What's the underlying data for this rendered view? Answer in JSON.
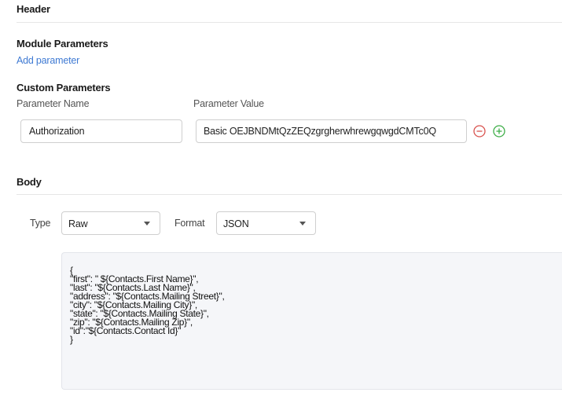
{
  "header": {
    "title": "Header"
  },
  "module_parameters": {
    "title": "Module Parameters",
    "add_link": "Add parameter"
  },
  "custom_parameters": {
    "title": "Custom Parameters",
    "name_column": "Parameter Name",
    "value_column": "Parameter Value",
    "rows": [
      {
        "name": "Authorization",
        "value": "Basic OEJBNDMtQzZEQzgrgherwhrewgqwgdCMTc0Q"
      }
    ]
  },
  "body": {
    "title": "Body",
    "type_label": "Type",
    "type_value": "Raw",
    "format_label": "Format",
    "format_value": "JSON",
    "code_lines": [
      "{",
      "\"first\": \" ${Contacts.First Name}\",",
      "\"last\": \"${Contacts.Last Name}\",",
      "\"address\": \"${Contacts.Mailing Street}\",",
      "\"city\": \"${Contacts.Mailing City}\",",
      "\"state\": \"${Contacts.Mailing State}\",",
      "\"zip\": \"${Contacts.Mailing Zip}\",",
      "\"id\":\"${Contacts.Contact Id}\"",
      "}"
    ]
  },
  "colors": {
    "link": "#3f7ad3",
    "remove_icon": "#d9534f",
    "add_icon": "#3fae49"
  },
  "icons": {
    "remove": "minus-circle-icon",
    "add": "plus-circle-icon"
  }
}
